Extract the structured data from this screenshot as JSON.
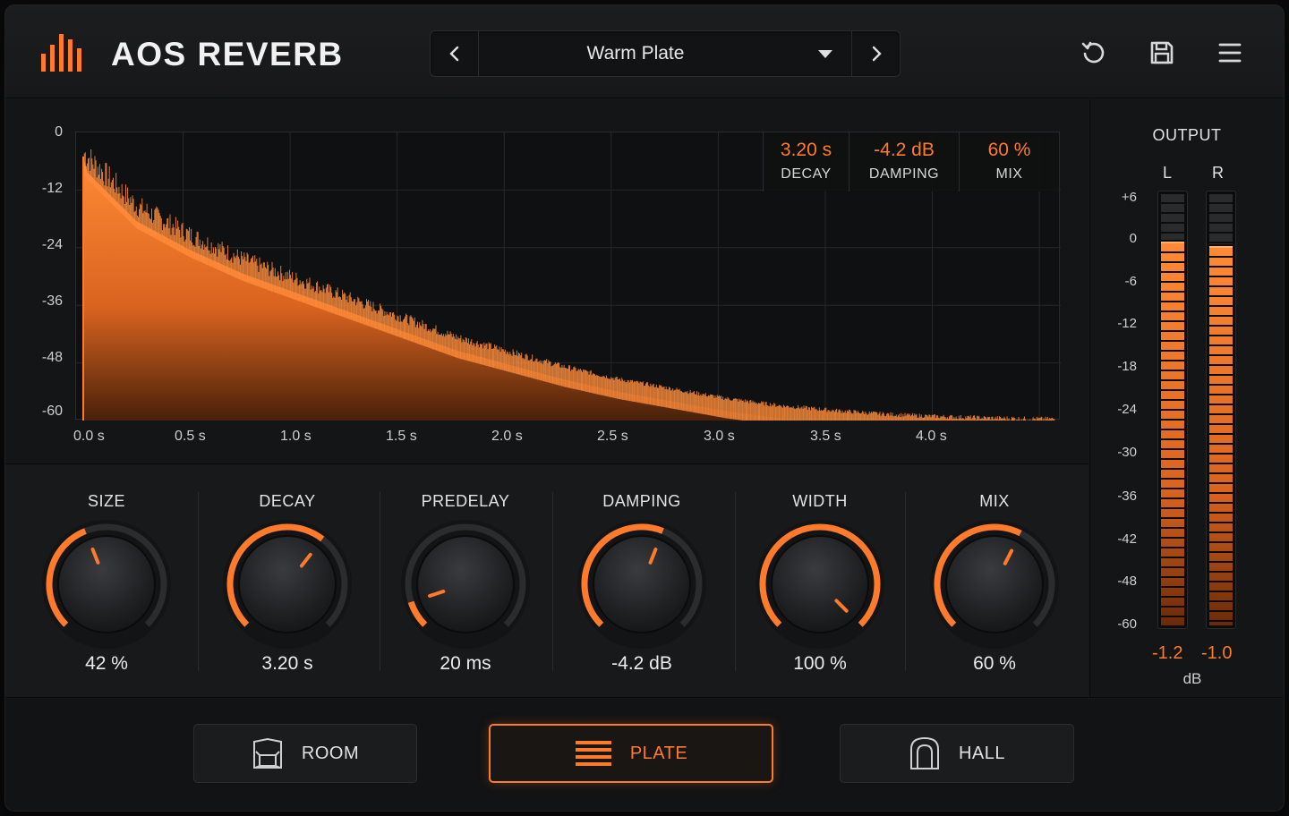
{
  "app": {
    "title": "AOS REVERB",
    "accent_color": "#ff7a2a"
  },
  "preset": {
    "name": "Warm Plate",
    "prev_icon": "chevron-left-icon",
    "next_icon": "chevron-right-icon",
    "dropdown_icon": "caret-down-icon"
  },
  "header_icons": [
    "reset-icon",
    "save-icon",
    "menu-icon"
  ],
  "graph": {
    "y_ticks": [
      "0",
      "-12",
      "-24",
      "-36",
      "-48",
      "-60"
    ],
    "x_ticks": [
      "0.0 s",
      "0.5 s",
      "1.0 s",
      "1.5 s",
      "2.0 s",
      "2.5 s",
      "3.0 s",
      "3.5 s",
      "4.0 s"
    ],
    "readouts": [
      {
        "value": "3.20 s",
        "label": "DECAY"
      },
      {
        "value": "-4.2 dB",
        "label": "DAMPING"
      },
      {
        "value": "60 %",
        "label": "MIX"
      }
    ]
  },
  "chart_data": {
    "type": "area",
    "x_range": [
      0,
      4.6
    ],
    "y_range": [
      -60,
      0
    ],
    "xlabel": "",
    "ylabel": "",
    "grid": true,
    "series": [
      {
        "x": [
          0.0,
          0.25,
          0.5,
          0.75,
          1.0,
          1.25,
          1.5,
          1.75,
          2.0,
          2.25,
          2.5,
          2.75,
          3.0,
          3.25,
          3.5,
          3.75,
          4.0,
          4.25,
          4.5
        ],
        "values": [
          -5,
          -16,
          -22,
          -27,
          -31,
          -35,
          -39,
          -43,
          -46,
          -49,
          -51.5,
          -53.5,
          -55.5,
          -57,
          -58,
          -58.8,
          -59.3,
          -59.6,
          -59.8
        ]
      }
    ]
  },
  "knobs": [
    {
      "label": "SIZE",
      "value": "42 %",
      "fraction": 0.42
    },
    {
      "label": "DECAY",
      "value": "3.20 s",
      "fraction": 0.64
    },
    {
      "label": "PREDELAY",
      "value": "20 ms",
      "fraction": 0.1
    },
    {
      "label": "DAMPING",
      "value": "-4.2 dB",
      "fraction": 0.58
    },
    {
      "label": "WIDTH",
      "value": "100 %",
      "fraction": 1.0
    },
    {
      "label": "MIX",
      "value": "60 %",
      "fraction": 0.6
    }
  ],
  "output": {
    "title": "OUTPUT",
    "channels": [
      {
        "label": "L",
        "peak": "-1.2",
        "level_db": -1.2
      },
      {
        "label": "R",
        "peak": "-1.0",
        "level_db": -2.0
      }
    ],
    "scale": [
      "+6",
      "0",
      "-6",
      "-12",
      "-18",
      "-24",
      "-30",
      "-36",
      "-42",
      "-48",
      "-60"
    ],
    "unit": "dB"
  },
  "modes": [
    {
      "label": "ROOM",
      "icon": "room-icon",
      "active": false
    },
    {
      "label": "PLATE",
      "icon": "plate-icon",
      "active": true
    },
    {
      "label": "HALL",
      "icon": "hall-icon",
      "active": false
    }
  ]
}
